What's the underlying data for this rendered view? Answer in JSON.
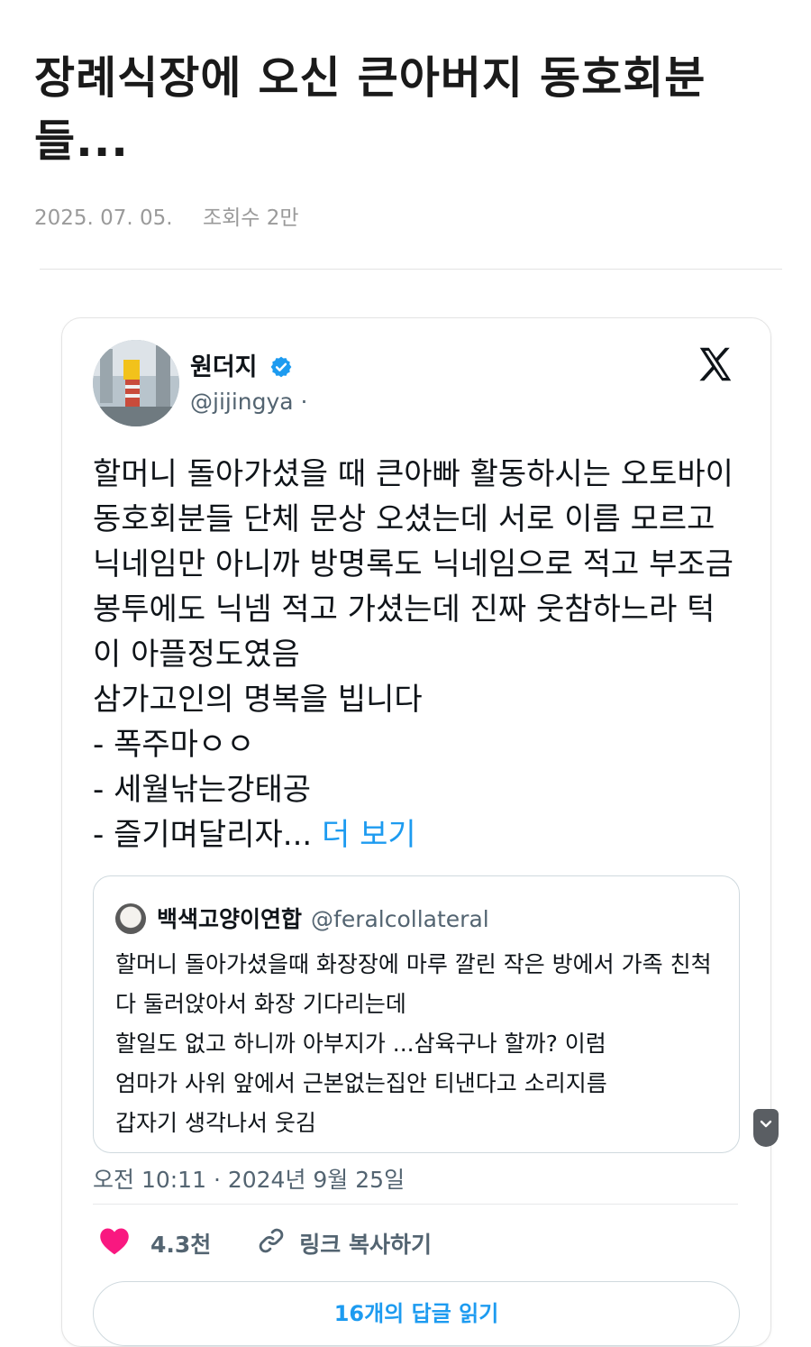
{
  "post": {
    "title": "장례식장에 오신 큰아버지 동호회분들...",
    "date": "2025. 07. 05.",
    "views": "조회수 2만"
  },
  "tweet": {
    "author_name": "원더지",
    "author_handle": "@jijingya ·",
    "body": "할머니 돌아가셨을 때 큰아빠 활동하시는 오토바이 동호회분들 단체 문상 오셨는데 서로 이름 모르고 닉네임만 아니까 방명록도 닉네임으로 적고 부조금 봉투에도 닉넴 적고 가셨는데 진짜 웃참하느라 턱이 아플정도였음\n삼가고인의 명복을 빕니다\n- 폭주마ㅇㅇ\n- 세월낚는강태공\n- 즐기며달리자... ",
    "more_label": "더 보기",
    "timestamp": "오전 10:11 · 2024년 9월 25일",
    "like_count": "4.3천",
    "copy_link_label": "링크 복사하기",
    "replies_label": "16개의 답글 읽기"
  },
  "quote": {
    "author_name": "백색고양이연합",
    "author_handle": "@feralcollateral",
    "body": "할머니 돌아가셨을때 화장장에 마루 깔린 작은 방에서 가족 친척 다 둘러앉아서 화장 기다리는데\n할일도 없고 하니까 아부지가 ...삼육구나 할까? 이럼\n엄마가 사위 앞에서 근본없는집안 티낸다고 소리지름\n갑자기 생각나서 웃김"
  },
  "icons": {
    "verified": "verified-badge-icon",
    "x_logo": "x-logo-icon",
    "heart": "heart-icon",
    "link": "link-icon",
    "scroll": "chevron-down-icon"
  },
  "colors": {
    "link_blue": "#1d9bf0",
    "heart_pink": "#f91880",
    "muted": "#536471"
  }
}
